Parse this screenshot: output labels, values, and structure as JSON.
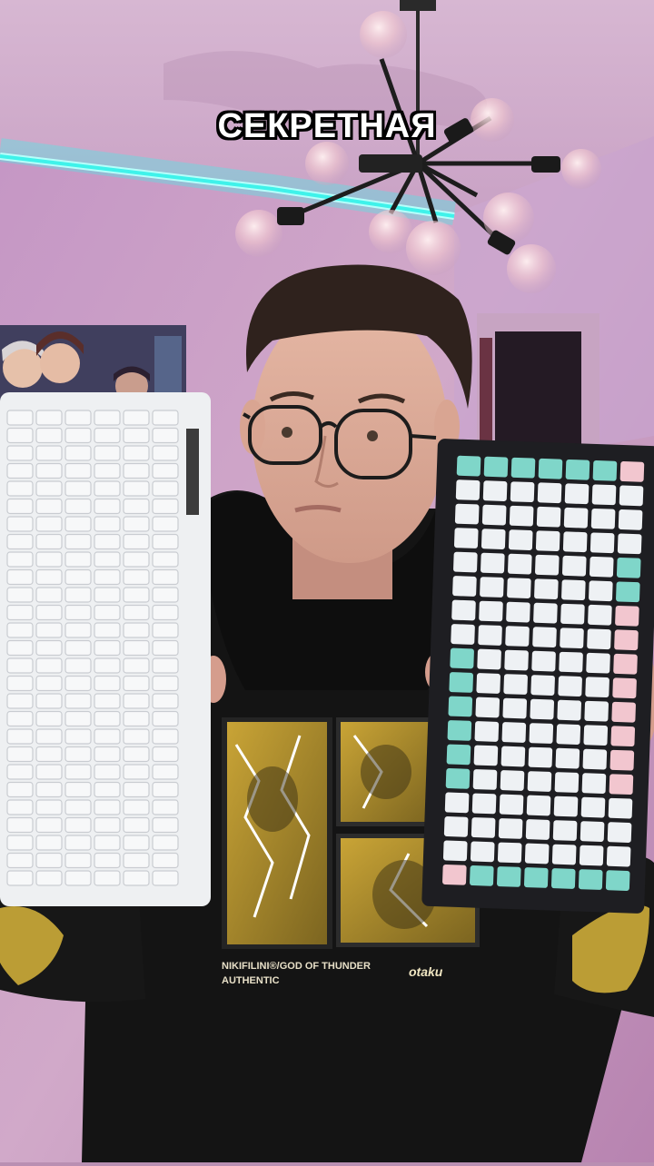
{
  "caption": "СЕКРЕТНАЯ",
  "shirt_print": {
    "line1": "NIKIFILINI®/GOD OF THUNDER",
    "line2": "AUTHENTIC",
    "brand": "otaku"
  },
  "colors": {
    "wall_pink": "#c79bc0",
    "led_cyan": "#3ff2ea",
    "keyboard_white": "#eef0f2",
    "keycap_mint": "#7fd6c9",
    "keycap_pink": "#f2c6cf",
    "hoodie_black": "#131313"
  }
}
